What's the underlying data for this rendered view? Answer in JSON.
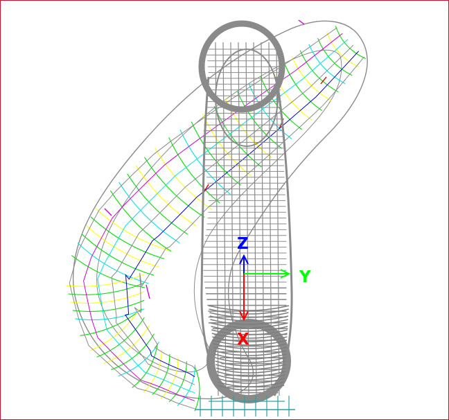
{
  "view": {
    "border_color": "#c8102e",
    "background": "#ffffff"
  },
  "triad": {
    "z_label": "Z",
    "y_label": "Y",
    "x_label": "X",
    "z_color": "#0000ff",
    "y_color": "#00ff00",
    "x_color": "#ff0000"
  },
  "model": {
    "palette": {
      "gray": "#8a8a8a",
      "dark_gray": "#7d7d7d",
      "green": "#00e000",
      "yellow": "#ffff00",
      "cyan": "#00e5e5",
      "blue": "#0000c8",
      "magenta": "#d400d4",
      "red": "#d40000",
      "teal": "#2aa0a0"
    }
  }
}
